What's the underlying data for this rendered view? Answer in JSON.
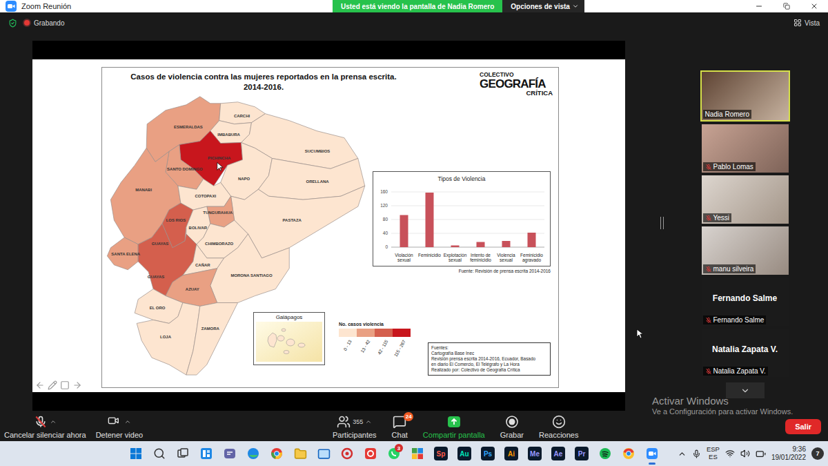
{
  "window": {
    "title": "Zoom Reunión"
  },
  "share_banner": {
    "text": "Usted está viendo la pantalla de Nadia Romero",
    "options": "Opciones de vista"
  },
  "status": {
    "recording": "Grabando",
    "view": "Vista"
  },
  "slide": {
    "title": "Casos de violencia contra las mujeres reportados en la prensa escrita.",
    "subtitle": "2014-2016.",
    "logo": [
      "COLECTIVO",
      "GEOGRAFÍA",
      "CRÍTICA"
    ],
    "provinces": [
      {
        "name": "ESMERALDAS",
        "color": "#e9a083"
      },
      {
        "name": "CARCHI",
        "color": "#fde5d0"
      },
      {
        "name": "IMBABURA",
        "color": "#fde5d0"
      },
      {
        "name": "SUCUMBIOS",
        "color": "#fde5d0"
      },
      {
        "name": "PICHINCHA",
        "color": "#c8161d"
      },
      {
        "name": "SANTO DOMINGO",
        "color": "#e9a083"
      },
      {
        "name": "NAPO",
        "color": "#fde5d0"
      },
      {
        "name": "ORELLANA",
        "color": "#fde5d0"
      },
      {
        "name": "MANABI",
        "color": "#e9a083"
      },
      {
        "name": "COTOPAXI",
        "color": "#fde5d0"
      },
      {
        "name": "PASTAZA",
        "color": "#fde5d0"
      },
      {
        "name": "TUNGURAHUA",
        "color": "#e9a083"
      },
      {
        "name": "LOS RIOS",
        "color": "#d45f4d"
      },
      {
        "name": "BOLIVAR",
        "color": "#fde5d0"
      },
      {
        "name": "SANTA ELENA",
        "color": "#e9a083"
      },
      {
        "name": "GUAYAS",
        "color": "#d45f4d"
      },
      {
        "name": "CHIMBORAZO",
        "color": "#fde5d0"
      },
      {
        "name": "CAÑAR",
        "color": "#fde5d0"
      },
      {
        "name": "MORONA SANTIAGO",
        "color": "#fde5d0"
      },
      {
        "name": "AZUAY",
        "color": "#e9a083"
      },
      {
        "name": "EL ORO",
        "color": "#fde5d0"
      },
      {
        "name": "LOJA",
        "color": "#fde5d0"
      },
      {
        "name": "ZAMORA",
        "color": "#fde5d0"
      }
    ],
    "galapagos": {
      "title": "Galápagos",
      "color": "#fde5d0"
    },
    "legend": {
      "title": "No. casos violencia",
      "classes": [
        {
          "label": "0 - 13",
          "color": "#fde5d0"
        },
        {
          "label": "13 - 42",
          "color": "#e9a083"
        },
        {
          "label": "42 - 115",
          "color": "#d45f4d"
        },
        {
          "label": "115 - 267",
          "color": "#c8161d"
        }
      ]
    },
    "chart": {
      "title": "Tipos de Violencia",
      "ticks": [
        "0",
        "40",
        "80",
        "120",
        "160"
      ],
      "categories": [
        "Violación sexual",
        "Feminicidio",
        "Explotación sexual",
        "Intento de feminicidio",
        "Violencia sexual",
        "Feminicidio agravado"
      ],
      "values": [
        93,
        158,
        5,
        15,
        18,
        42
      ],
      "source": "Fuente: Revisión de prensa escrita 2014-2016"
    },
    "sources": [
      "Fuentes:",
      "Cartografía Base Inec",
      "Revisión prensa escrita 2014-2016, Ecuador, Basado",
      "en diario El Comercio, El Telégrafo y La Hora",
      "Realizado por: Colectivo de Geografía Crítica"
    ]
  },
  "participants": [
    {
      "name": "Nadia Romero",
      "video": true,
      "muted": false,
      "speaking": true
    },
    {
      "name": "Pablo Lomas",
      "video": true,
      "muted": true,
      "speaking": false
    },
    {
      "name": "Yessi",
      "video": true,
      "muted": true,
      "speaking": false
    },
    {
      "name": "manu silveira",
      "video": true,
      "muted": true,
      "speaking": false
    },
    {
      "name": "Fernando Salme",
      "video": false,
      "muted": true,
      "speaking": false
    },
    {
      "name": "Natalia Zapata V.",
      "video": false,
      "muted": true,
      "speaking": false
    }
  ],
  "watermark": [
    "Activar Windows",
    "Ve a Configuración para activar Windows."
  ],
  "toolbar": {
    "audio": {
      "label": "Cancelar silenciar ahora",
      "muted": true
    },
    "video": {
      "label": "Detener video",
      "on": true
    },
    "participants": {
      "label": "Participantes",
      "count": "355"
    },
    "chat": {
      "label": "Chat",
      "badge": "24"
    },
    "share": {
      "label": "Compartir pantalla"
    },
    "record": {
      "label": "Grabar"
    },
    "reactions": {
      "label": "Reacciones"
    },
    "leave": "Salir"
  },
  "taskbar": {
    "apps": [
      {
        "kind": "glyph",
        "badge": "",
        "active": false
      },
      {
        "kind": "glyph",
        "badge": "",
        "active": false
      },
      {
        "kind": "glyph",
        "badge": "",
        "active": false
      },
      {
        "kind": "glyph",
        "badge": "",
        "active": false
      },
      {
        "kind": "glyph",
        "badge": "",
        "active": false
      },
      {
        "kind": "glyph",
        "badge": "",
        "active": false
      },
      {
        "kind": "glyph",
        "badge": "",
        "active": false
      },
      {
        "kind": "glyph",
        "badge": "",
        "active": false
      },
      {
        "kind": "glyph",
        "badge": "",
        "active": false
      },
      {
        "kind": "glyph",
        "badge": "",
        "active": false
      },
      {
        "kind": "glyph",
        "badge": "",
        "active": false
      },
      {
        "kind": "glyph",
        "badge": "3",
        "active": false
      },
      {
        "kind": "glyph",
        "badge": "",
        "active": false
      },
      {
        "kind": "letters",
        "text": "Sp",
        "color": "#ff5a4a",
        "active": false
      },
      {
        "kind": "letters",
        "text": "Au",
        "color": "#00e4bb",
        "active": false
      },
      {
        "kind": "letters",
        "text": "Ps",
        "color": "#31a8ff",
        "active": false
      },
      {
        "kind": "letters",
        "text": "Ai",
        "color": "#ff9a00",
        "active": false
      },
      {
        "kind": "letters",
        "text": "Me",
        "color": "#9999ff",
        "active": false
      },
      {
        "kind": "letters",
        "text": "Ae",
        "color": "#9999ff",
        "active": false
      },
      {
        "kind": "letters",
        "text": "Pr",
        "color": "#9999ff",
        "active": false
      },
      {
        "kind": "glyph",
        "badge": "",
        "active": false
      },
      {
        "kind": "glyph",
        "badge": "",
        "active": false
      },
      {
        "kind": "glyph",
        "badge": "",
        "active": true
      }
    ],
    "tray": {
      "language": "ESP",
      "layout": "ES",
      "time": "9:36",
      "date": "19/01/2022",
      "notifications": "7"
    }
  }
}
